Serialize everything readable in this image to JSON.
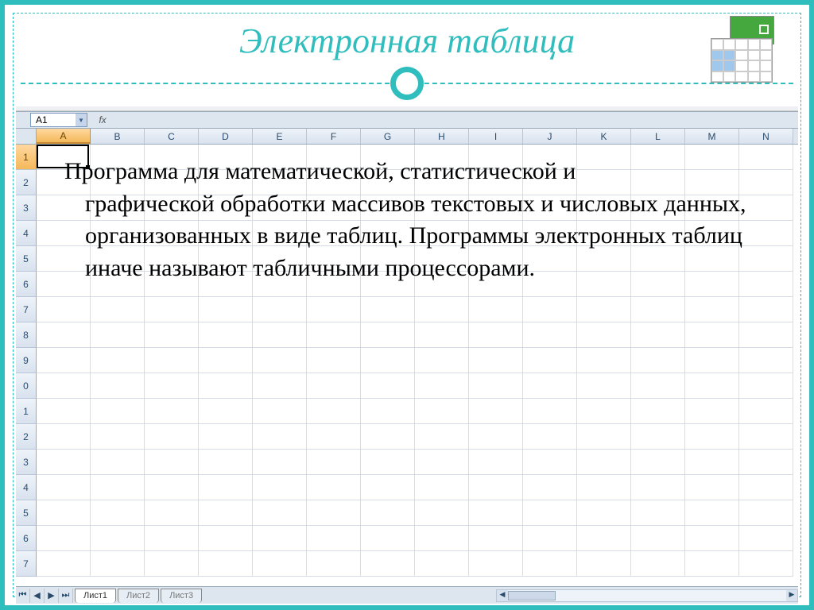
{
  "title": "Электронная таблица",
  "name_box": "A1",
  "fx_label": "fx",
  "columns": [
    "A",
    "B",
    "C",
    "D",
    "E",
    "F",
    "G",
    "H",
    "I",
    "J",
    "K",
    "L",
    "M",
    "N"
  ],
  "rows": [
    "1",
    "2",
    "3",
    "4",
    "5",
    "6",
    "7",
    "8",
    "9",
    "0",
    "1",
    "2",
    "3",
    "4",
    "5",
    "6",
    "7"
  ],
  "body_text_first": "Программа для математической, статистической и",
  "body_text_rest": "графической обработки массивов текстовых и числовых данных, организованных в виде таблиц. Программы электронных таблиц иначе называют табличными процессорами.",
  "tabs": [
    "Лист1",
    "Лист2",
    "Лист3"
  ]
}
